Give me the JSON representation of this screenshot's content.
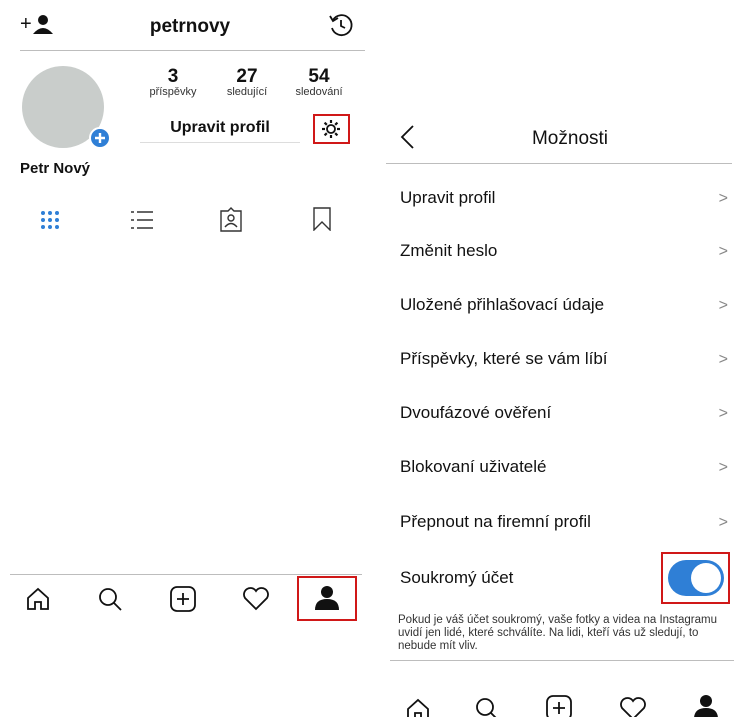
{
  "profile": {
    "username": "petrnovy",
    "display_name": "Petr Nový",
    "edit_button": "Upravit profil",
    "stats": [
      {
        "value": "3",
        "label": "příspěvky"
      },
      {
        "value": "27",
        "label": "sledující"
      },
      {
        "value": "54",
        "label": "sledování"
      }
    ],
    "add_user_icon": "+"
  },
  "settings": {
    "back_glyph": "<",
    "title": "Možnosti",
    "items": [
      {
        "label": "Upravit profil"
      },
      {
        "label": "Změnit heslo"
      },
      {
        "label": "Uložené přihlašovací údaje"
      },
      {
        "label": "Příspěvky, které se vám líbí"
      },
      {
        "label": "Dvoufázové ověření"
      },
      {
        "label": "Blokovaní uživatelé"
      },
      {
        "label": "Přepnout na firemní profil"
      }
    ],
    "private_account_label": "Soukromý účet",
    "private_account_on": true,
    "private_account_note": "Pokud je váš účet soukromý, vaše fotky a videa na Instagramu uvidí jen lidé, které schválíte. Na lidi, kteří vás už sledují, to nebude mít vliv.",
    "chevron_glyph": ">"
  },
  "colors": {
    "accent_blue": "#2f7fd6",
    "highlight_red": "#d01818",
    "avatar_gray": "#c9cdcb"
  },
  "icons": [
    "add-user-icon",
    "history-icon",
    "gear-icon",
    "grid-icon",
    "list-icon",
    "tagged-icon",
    "bookmark-icon",
    "home-icon",
    "search-icon",
    "add-post-icon",
    "heart-icon",
    "profile-icon",
    "back-icon",
    "chevron-right-icon"
  ]
}
